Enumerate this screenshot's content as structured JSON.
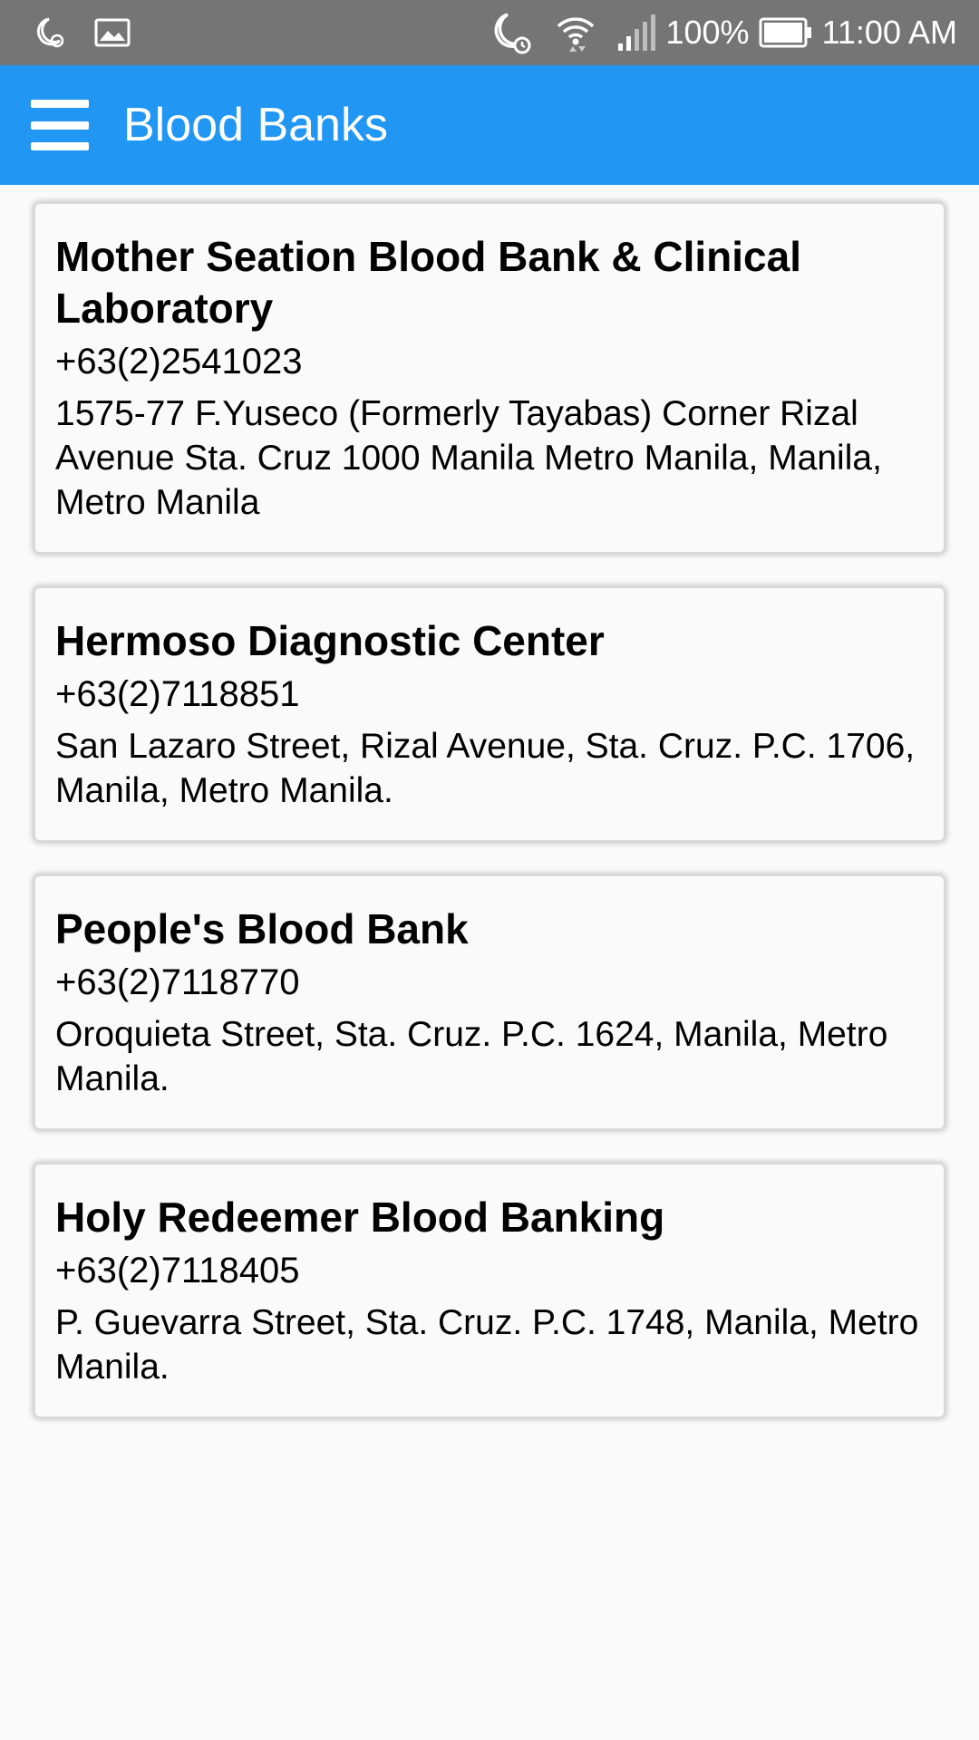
{
  "status_bar": {
    "battery": "100%",
    "time": "11:00 AM",
    "icons": [
      "alarm-moon-icon",
      "image-icon",
      "do-not-disturb-alarm-icon",
      "wifi-icon",
      "signal-icon",
      "battery-icon"
    ]
  },
  "app_bar": {
    "title": "Blood Banks",
    "color": "#2196f3"
  },
  "blood_banks": [
    {
      "name": "Mother Seation Blood Bank & Clinical Laboratory",
      "phone": "+63(2)2541023",
      "address": "1575-77 F.Yuseco (Formerly Tayabas) Corner Rizal Avenue Sta. Cruz 1000 Manila Metro Manila, Manila, Metro Manila"
    },
    {
      "name": "Hermoso Diagnostic Center",
      "phone": "+63(2)7118851",
      "address": "San Lazaro Street, Rizal Avenue, Sta. Cruz. P.C. 1706, Manila, Metro Manila."
    },
    {
      "name": "People's Blood Bank",
      "phone": "+63(2)7118770",
      "address": "Oroquieta Street, Sta. Cruz. P.C. 1624, Manila, Metro Manila."
    },
    {
      "name": "Holy Redeemer Blood Banking",
      "phone": "+63(2)7118405",
      "address": "P. Guevarra Street, Sta. Cruz. P.C. 1748, Manila, Metro Manila."
    }
  ]
}
